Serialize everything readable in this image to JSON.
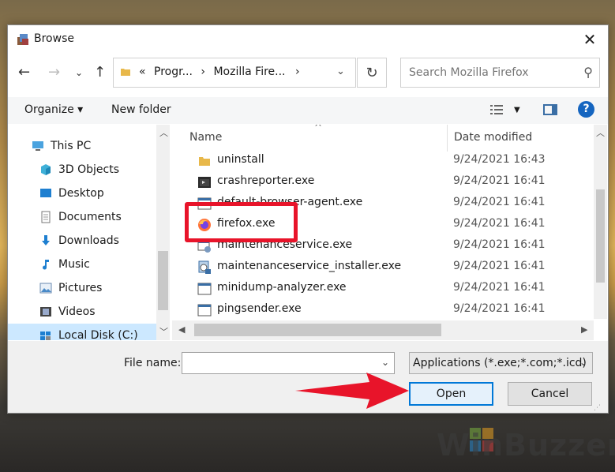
{
  "window": {
    "title": "Browse"
  },
  "address": {
    "crumbs": [
      "«",
      "Progr...",
      "›",
      "Mozilla Fire...",
      "›"
    ]
  },
  "search": {
    "placeholder": "Search Mozilla Firefox"
  },
  "toolbar": {
    "organize": "Organize ▾",
    "new_folder": "New folder",
    "help": "?"
  },
  "nav": {
    "items": [
      {
        "label": "This PC",
        "icon": "pc-icon"
      },
      {
        "label": "3D Objects",
        "icon": "3d-objects-icon"
      },
      {
        "label": "Desktop",
        "icon": "desktop-icon"
      },
      {
        "label": "Documents",
        "icon": "documents-icon"
      },
      {
        "label": "Downloads",
        "icon": "downloads-icon"
      },
      {
        "label": "Music",
        "icon": "music-icon"
      },
      {
        "label": "Pictures",
        "icon": "pictures-icon"
      },
      {
        "label": "Videos",
        "icon": "videos-icon"
      },
      {
        "label": "Local Disk (C:)",
        "icon": "local-disk-icon"
      }
    ]
  },
  "columns": {
    "name": "Name",
    "date": "Date modified"
  },
  "files": [
    {
      "name": "uninstall",
      "date": "9/24/2021 16:43",
      "icon": "folder-icon"
    },
    {
      "name": "crashreporter.exe",
      "date": "9/24/2021 16:41",
      "icon": "exe-icon"
    },
    {
      "name": "default-browser-agent.exe",
      "date": "9/24/2021 16:41",
      "icon": "exe-icon"
    },
    {
      "name": "firefox.exe",
      "date": "9/24/2021 16:41",
      "icon": "firefox-icon"
    },
    {
      "name": "maintenanceservice.exe",
      "date": "9/24/2021 16:41",
      "icon": "exe-icon"
    },
    {
      "name": "maintenanceservice_installer.exe",
      "date": "9/24/2021 16:41",
      "icon": "installer-icon"
    },
    {
      "name": "minidump-analyzer.exe",
      "date": "9/24/2021 16:41",
      "icon": "exe-icon"
    },
    {
      "name": "pingsender.exe",
      "date": "9/24/2021 16:41",
      "icon": "exe-icon"
    }
  ],
  "bottom": {
    "file_name_label": "File name:",
    "file_name_value": "",
    "filter": "Applications (*.exe;*.com;*.icd)",
    "open": "Open",
    "cancel": "Cancel"
  },
  "watermark": "WinBuzzer",
  "colors": {
    "accent": "#0078d7",
    "highlight": "#e8142a",
    "help": "#1565c0"
  }
}
